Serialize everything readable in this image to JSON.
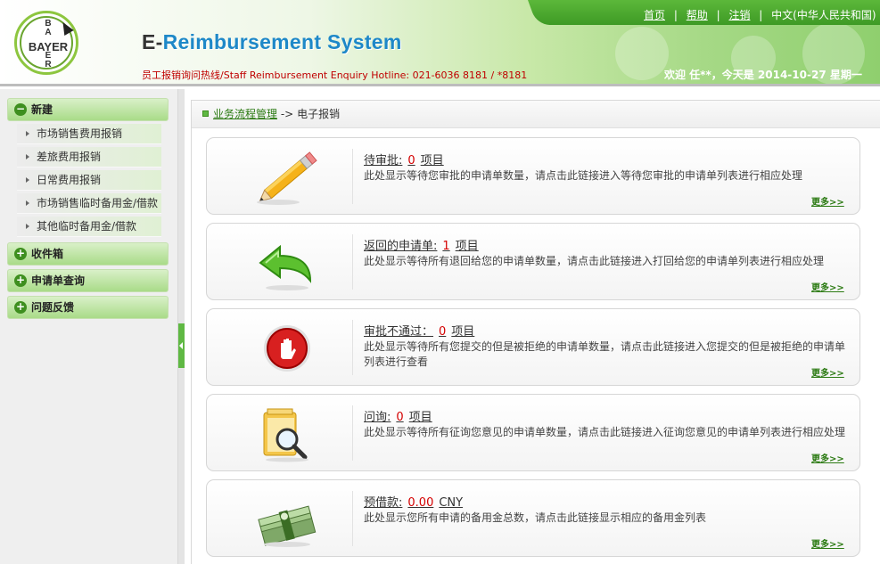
{
  "header": {
    "logo_text_h": "BAYER",
    "logo_text_v_top": "BA",
    "logo_text_v_bottom": "ER",
    "title_prefix": "E-",
    "title_main": "Reimbursement System",
    "hotline": "员工报销询问热线/Staff Reimbursement Enquiry Hotline: 021-6036 8181 / *8181",
    "nav": [
      "首页",
      "帮助",
      "注销",
      "中文(中华人民共和国)"
    ],
    "welcome": "欢迎 任**，今天是 2014-10-27 星期一"
  },
  "sidebar": {
    "groups": [
      {
        "label": "新建",
        "icon": "minus"
      },
      {
        "label": "收件箱",
        "icon": "plus"
      },
      {
        "label": "申请单查询",
        "icon": "plus"
      },
      {
        "label": "问题反馈",
        "icon": "plus"
      }
    ],
    "items": [
      "市场销售费用报销",
      "差旅费用报销",
      "日常费用报销",
      "市场销售临时备用金/借款",
      "其他临时备用金/借款"
    ]
  },
  "breadcrumb": {
    "link": "业务流程管理",
    "sep": "->",
    "current": "电子报销"
  },
  "cards": [
    {
      "title": "待审批:",
      "count": "0",
      "unit": "项目",
      "desc": "此处显示等待您审批的申请单数量，请点击此链接进入等待您审批的申请单列表进行相应处理",
      "more": "更多>>",
      "icon": "pencil-icon"
    },
    {
      "title": "返回的申请单:",
      "count": "1",
      "unit": "项目",
      "desc": "此处显示等待所有退回给您的申请单数量，请点击此链接进入打回给您的申请单列表进行相应处理",
      "more": "更多>>",
      "icon": "return-arrow-icon"
    },
    {
      "title": "审批不通过：",
      "count": "0",
      "unit": "项目",
      "desc": "此处显示等待所有您提交的但是被拒绝的申请单数量，请点击此链接进入您提交的但是被拒绝的申请单列表进行查看",
      "more": "更多>>",
      "icon": "stop-hand-icon"
    },
    {
      "title": "问询:",
      "count": "0",
      "unit": "项目",
      "desc": "此处显示等待所有征询您意见的申请单数量，请点击此链接进入征询您意见的申请单列表进行相应处理",
      "more": "更多>>",
      "icon": "folder-search-icon"
    },
    {
      "title": "预借款:",
      "count": "0.00",
      "unit": "CNY",
      "desc": "此处显示您所有申请的备用金总数，请点击此链接显示相应的备用金列表",
      "more": "更多>>",
      "icon": "money-icon"
    }
  ],
  "colors": {
    "accent": "#5fb843",
    "count": "#d40000",
    "title_blue": "#1e88c8"
  }
}
